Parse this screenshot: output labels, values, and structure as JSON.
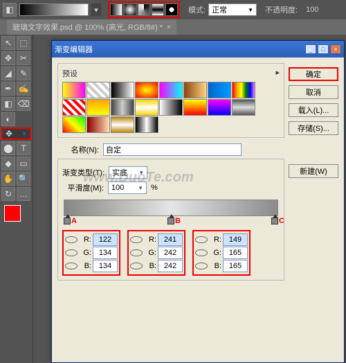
{
  "topbar": {
    "mode_label": "模式:",
    "mode_value": "正常",
    "opacity_label": "不透明度:",
    "opacity_value": "100"
  },
  "tab": {
    "title": "玻璃文字效果.psd @ 100% (高光, RGB/8#) *",
    "close": "×"
  },
  "tools": [
    {
      "g": "↖"
    },
    {
      "g": "⬚"
    },
    {
      "g": "✥"
    },
    {
      "g": "✂"
    },
    {
      "g": "◢"
    },
    {
      "g": "✎"
    },
    {
      "g": "✒"
    },
    {
      "g": "✍"
    },
    {
      "g": "◧"
    },
    {
      "g": "⌫"
    },
    {
      "g": "◐"
    },
    {
      "g": "✥"
    },
    {
      "g": "⬤"
    },
    {
      "g": "T"
    },
    {
      "g": "◆"
    },
    {
      "g": "▭"
    },
    {
      "g": "✋"
    },
    {
      "g": "🔍"
    },
    {
      "g": "↻"
    },
    {
      "g": "…"
    }
  ],
  "dialog": {
    "title": "渐变编辑器",
    "preset_label": "预设",
    "buttons": {
      "ok": "确定",
      "cancel": "取消",
      "load": "载入(L)...",
      "save": "存储(S)...",
      "new": "新建(W)"
    },
    "name_label": "名称(N):",
    "name_value": "自定",
    "type_label": "渐变类型(T):",
    "type_value": "实底",
    "smooth_label": "平滑度(M):",
    "smooth_value": "100",
    "smooth_unit": "%",
    "stops": {
      "a": "A",
      "b": "B",
      "c": "C"
    },
    "rgb": {
      "a": {
        "r": "122",
        "g": "134",
        "b": "134"
      },
      "b": {
        "r": "241",
        "g": "242",
        "b": "242"
      },
      "c": {
        "r": "149",
        "g": "165",
        "b": "165"
      }
    }
  },
  "watermark": "www.DuoTe.com",
  "preset_styles": [
    "linear-gradient(90deg,#ff0,#f0f)",
    "repeating-linear-gradient(45deg,#fff 0 4px,#ccc 4px 8px)",
    "linear-gradient(90deg,#000,#fff)",
    "radial-gradient(#ff0,#f00)",
    "linear-gradient(90deg,#f0f,#0ff)",
    "linear-gradient(90deg,#8b4513,#ffd27f)",
    "linear-gradient(90deg,#06c,#09f)",
    "linear-gradient(90deg,red,orange,yellow,green,blue,violet)",
    "repeating-linear-gradient(45deg,#f00 0 4px,#fff 4px 8px)",
    "linear-gradient(#ffa500,#ff0)",
    "linear-gradient(90deg,#444,#ccc,#444)",
    "linear-gradient(#ffd700,#fff,#ffd700)",
    "linear-gradient(90deg,#fff,#000)",
    "linear-gradient(#ff0,#f00)",
    "linear-gradient(#f0f,#00f)",
    "linear-gradient(#555,#ddd,#555)",
    "linear-gradient(45deg,#f00,#ff0,#0f0)",
    "linear-gradient(90deg,#8b0000,#ffdead)",
    "linear-gradient(#b8860b,#fff,#b8860b)",
    "linear-gradient(90deg,#000,#fff,#000)"
  ]
}
